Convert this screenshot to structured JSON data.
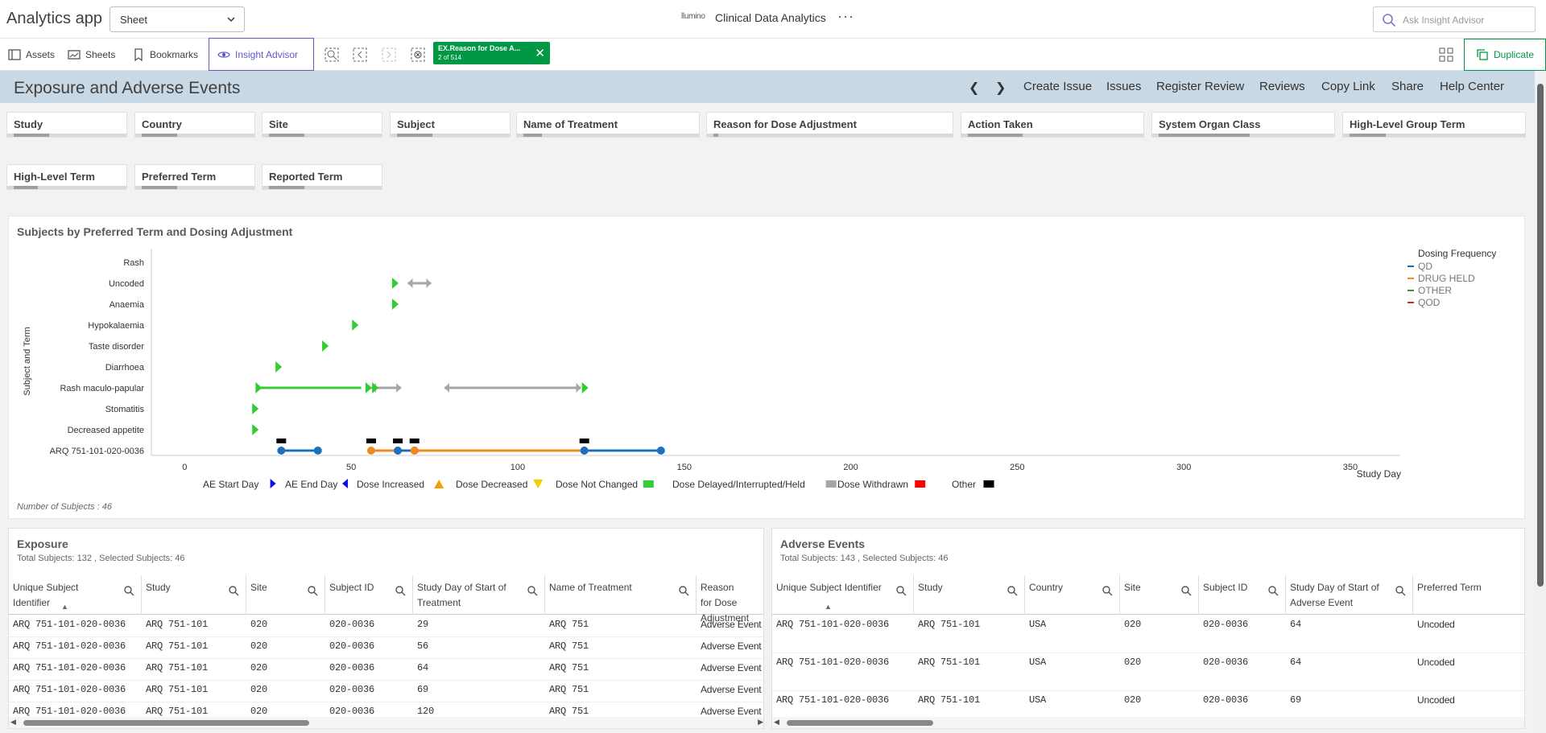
{
  "app": {
    "title": "Analytics app",
    "sheet_select": "Sheet",
    "brand": "llumino",
    "center_title": "Clinical Data Analytics",
    "more": "···",
    "ask_placeholder": "Ask Insight Advisor"
  },
  "toolbar": {
    "assets": "Assets",
    "sheets": "Sheets",
    "bookmarks": "Bookmarks",
    "insight": "Insight Advisor",
    "selection_field": "EX.Reason for Dose A...",
    "selection_count": "2 of 514",
    "duplicate": "Duplicate"
  },
  "sheet": {
    "title": "Exposure and Adverse Events",
    "links": [
      "Create Issue",
      "Issues",
      "Register Review",
      "Reviews",
      "Copy Link",
      "Share",
      "Help Center"
    ]
  },
  "filters_row1": [
    "Study",
    "Country",
    "Site",
    "Subject",
    "Name of Treatment",
    "Reason for Dose Adjustment",
    "Action Taken",
    "System Organ Class",
    "High-Level Group Term"
  ],
  "filters_row2": [
    "High-Level Term",
    "Preferred Term",
    "Reported Term"
  ],
  "filter_fill": [
    0.3,
    0.3,
    0.3,
    0.3,
    0.1,
    0.01,
    0.3,
    0.5,
    0.2,
    0.2,
    0.3,
    0.3
  ],
  "chart_data": {
    "type": "scatter",
    "title": "Subjects by Preferred Term and Dosing Adjustment",
    "ylabel": "Subject and Term",
    "xlabel": "Study Day",
    "x_ticks": [
      0,
      50,
      100,
      150,
      200,
      250,
      300,
      350
    ],
    "xlim": [
      -10,
      365
    ],
    "categories": [
      "Rash",
      "Uncoded",
      "Anaemia",
      "Hypokalaemia",
      "Taste disorder",
      "Diarrhoea",
      "Rash maculo-papular",
      "Stomatitis",
      "Decreased appetite",
      "ARQ 751-101-020-0036"
    ],
    "dose_delayed": [
      {
        "term": "Uncoded",
        "x": 63
      },
      {
        "term": "Anaemia",
        "x": 63
      },
      {
        "term": "Hypokalaemia",
        "x": 51
      },
      {
        "term": "Taste disorder",
        "x": 42
      },
      {
        "term": "Diarrhoea",
        "x": 28
      },
      {
        "term": "Rash maculo-papular",
        "x": 22
      },
      {
        "term": "Rash maculo-papular",
        "x": 55
      },
      {
        "term": "Rash maculo-papular",
        "x": 57
      },
      {
        "term": "Rash maculo-papular",
        "x": 120
      },
      {
        "term": "Stomatitis",
        "x": 21
      },
      {
        "term": "Decreased appetite",
        "x": 21
      }
    ],
    "dose_delayed_spans": [
      {
        "term": "Rash maculo-papular",
        "from": 22,
        "to": 53
      }
    ],
    "dose_withdrawn_spans": [
      {
        "term": "Uncoded",
        "from": 67,
        "to": 74
      },
      {
        "term": "Rash maculo-papular",
        "from": 56,
        "to": 65
      },
      {
        "term": "Rash maculo-papular",
        "from": 78,
        "to": 119
      }
    ],
    "exposure_segments": [
      {
        "from": 29,
        "to": 40,
        "freq": "QD"
      },
      {
        "from": 56,
        "to": 67,
        "freq": "DRUG HELD"
      },
      {
        "from": 64,
        "to": 69,
        "freq": "QD"
      },
      {
        "from": 69,
        "to": 120,
        "freq": "DRUG HELD"
      },
      {
        "from": 120,
        "to": 143,
        "freq": "QD"
      }
    ],
    "exposure_points": [
      {
        "x": 29,
        "freq": "QD"
      },
      {
        "x": 40,
        "freq": "QD"
      },
      {
        "x": 56,
        "freq": "DRUG HELD"
      },
      {
        "x": 64,
        "freq": "DRUG HELD"
      },
      {
        "x": 64,
        "freq": "QD"
      },
      {
        "x": 69,
        "freq": "QD"
      },
      {
        "x": 69,
        "freq": "DRUG HELD"
      },
      {
        "x": 120,
        "freq": "DRUG HELD"
      },
      {
        "x": 120,
        "freq": "QD"
      },
      {
        "x": 143,
        "freq": "QD"
      }
    ],
    "other_markers": [
      29,
      56,
      64,
      69,
      120
    ],
    "legend_title": "Dosing Frequency",
    "legend": [
      {
        "name": "QD",
        "color": "#1f6fbf"
      },
      {
        "name": "DRUG HELD",
        "color": "#f08a1c"
      },
      {
        "name": "OTHER",
        "color": "#2ca02c"
      },
      {
        "name": "QOD",
        "color": "#d62728"
      }
    ],
    "bottom_legend": [
      {
        "label": "AE Start Day",
        "shape": "tri-right",
        "color": "#1010e0"
      },
      {
        "label": "AE End Day",
        "shape": "tri-left",
        "color": "#1010e0"
      },
      {
        "label": "Dose Increased",
        "shape": "tri-up",
        "color": "#f0a000"
      },
      {
        "label": "Dose Decreased",
        "shape": "tri-down",
        "color": "#f0d000"
      },
      {
        "label": "Dose Not Changed",
        "shape": "rect",
        "color": "#33cc33"
      },
      {
        "label": "Dose Delayed/Interrupted/Held",
        "shape": "rect",
        "color": "#a6a6a6"
      },
      {
        "label": "Dose Withdrawn",
        "shape": "rect",
        "color": "#ff0000"
      },
      {
        "label": "Other",
        "shape": "rect",
        "color": "#000000"
      }
    ],
    "footer": "Number of Subjects : 46"
  },
  "exposure": {
    "title": "Exposure",
    "subtitle": "Total Subjects: 132 , Selected Subjects: 46",
    "columns": [
      "Unique Subject Identifier",
      "Study",
      "Site",
      "Subject ID",
      "Study Day of Start of Treatment",
      "Name of Treatment",
      "Reason for Dose Adjustment"
    ],
    "rows": [
      [
        "ARQ 751-101-020-0036",
        "ARQ 751-101",
        "020",
        "020-0036",
        "29",
        "ARQ 751",
        "Adverse Event"
      ],
      [
        "ARQ 751-101-020-0036",
        "ARQ 751-101",
        "020",
        "020-0036",
        "56",
        "ARQ 751",
        "Adverse Event"
      ],
      [
        "ARQ 751-101-020-0036",
        "ARQ 751-101",
        "020",
        "020-0036",
        "64",
        "ARQ 751",
        "Adverse Event"
      ],
      [
        "ARQ 751-101-020-0036",
        "ARQ 751-101",
        "020",
        "020-0036",
        "69",
        "ARQ 751",
        "Adverse Event"
      ],
      [
        "ARQ 751-101-020-0036",
        "ARQ 751-101",
        "020",
        "020-0036",
        "120",
        "ARQ 751",
        "Adverse Event"
      ]
    ]
  },
  "adverse": {
    "title": "Adverse Events",
    "subtitle": "Total Subjects: 143 , Selected Subjects: 46",
    "columns": [
      "Unique Subject Identifier",
      "Study",
      "Country",
      "Site",
      "Subject ID",
      "Study Day of Start of Adverse Event",
      "Preferred Term"
    ],
    "rows": [
      [
        "ARQ 751-101-020-0036",
        "ARQ 751-101",
        "USA",
        "020",
        "020-0036",
        "64",
        "Uncoded"
      ],
      [
        "ARQ 751-101-020-0036",
        "ARQ 751-101",
        "USA",
        "020",
        "020-0036",
        "64",
        "Uncoded"
      ],
      [
        "ARQ 751-101-020-0036",
        "ARQ 751-101",
        "USA",
        "020",
        "020-0036",
        "69",
        "Uncoded"
      ]
    ]
  }
}
